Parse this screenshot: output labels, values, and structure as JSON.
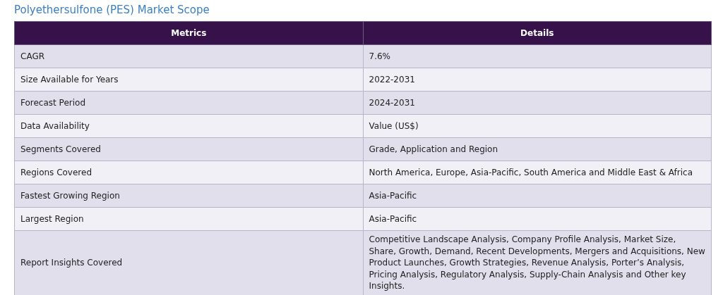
{
  "title": "Polyethersulfone (PES) Market Scope",
  "table": {
    "columns": [
      "Metrics",
      "Details"
    ],
    "rows": [
      {
        "metric": "CAGR",
        "details": "7.6%"
      },
      {
        "metric": "Size Available for Years",
        "details": "2022-2031"
      },
      {
        "metric": "Forecast Period",
        "details": "2024-2031"
      },
      {
        "metric": "Data Availability",
        "details": "Value (US$)"
      },
      {
        "metric": "Segments Covered",
        "details": "Grade, Application and Region"
      },
      {
        "metric": "Regions Covered",
        "details": "North America, Europe, Asia-Pacific, South America and Middle East & Africa"
      },
      {
        "metric": "Fastest Growing Region",
        "details": "Asia-Pacific"
      },
      {
        "metric": "Largest Region",
        "details": "Asia-Pacific"
      },
      {
        "metric": "Report Insights Covered",
        "details": "Competitive Landscape Analysis, Company Profile Analysis, Market Size, Share, Growth, Demand, Recent Developments, Mergers and Acquisitions, New Product Launches, Growth Strategies, Revenue Analysis, Porter’s Analysis, Pricing Analysis, Regulatory Analysis, Supply-Chain Analysis and Other key Insights."
      }
    ]
  }
}
